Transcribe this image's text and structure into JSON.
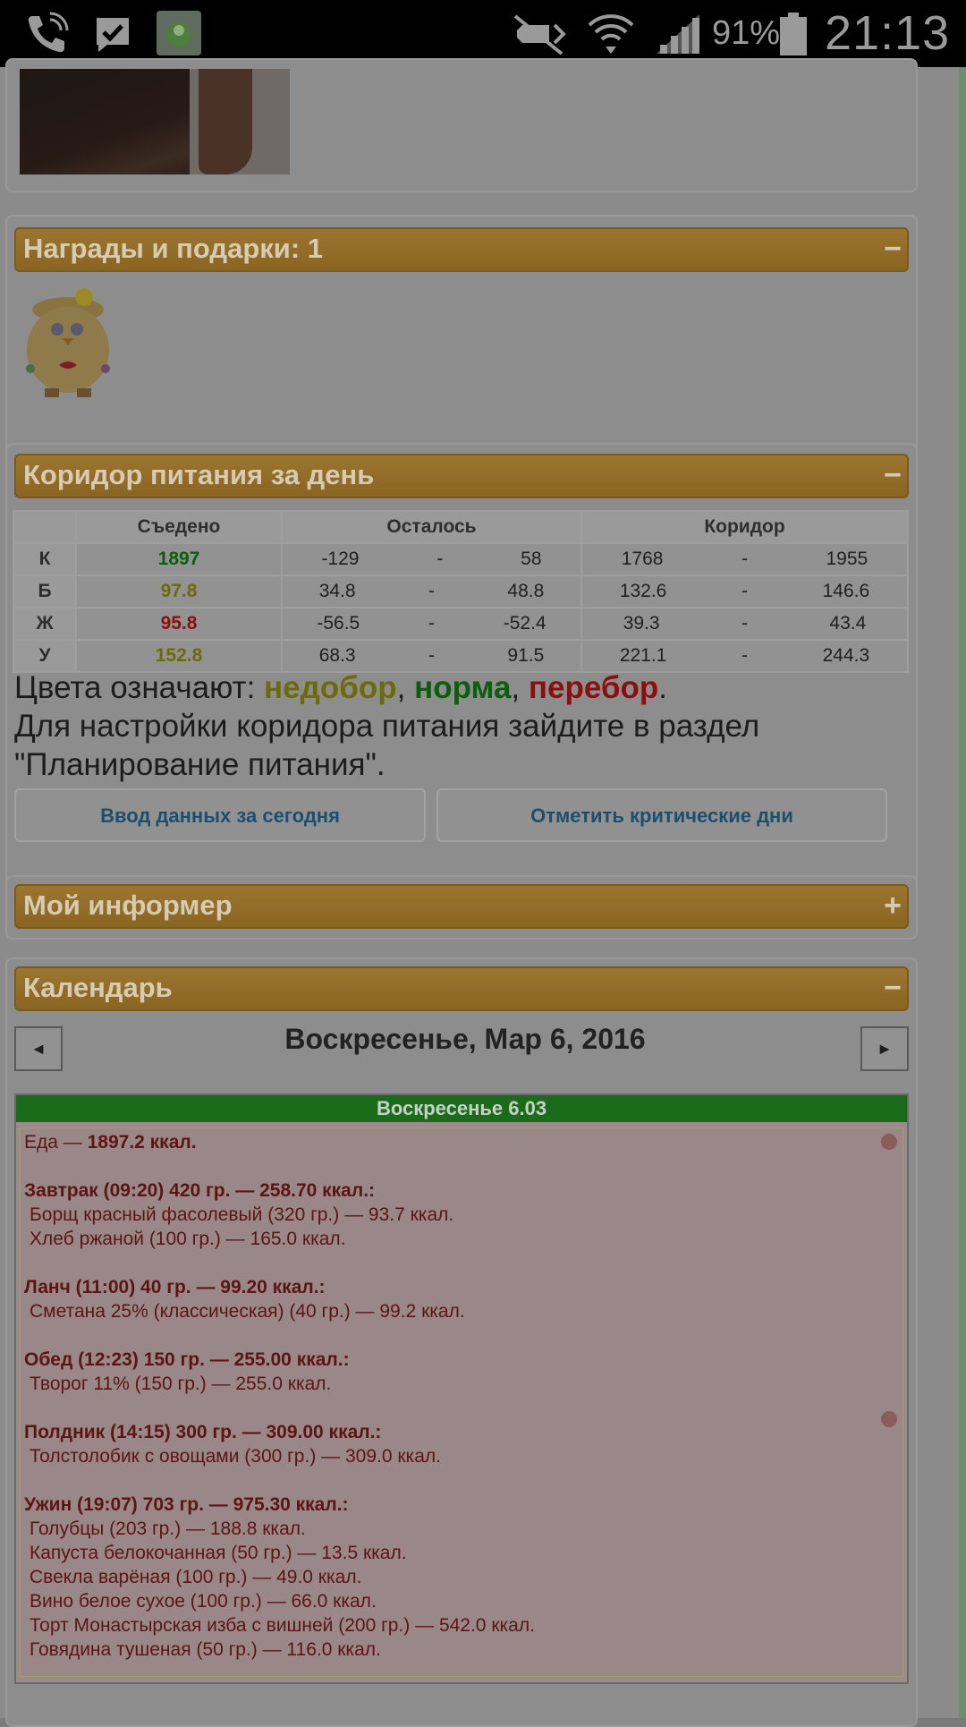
{
  "status_bar": {
    "battery": "91%",
    "time": "21:13",
    "icons": [
      "phone-icon",
      "check-icon",
      "app-icon",
      "mute-icon",
      "wifi-icon",
      "signal-icon",
      "battery-icon"
    ]
  },
  "awards": {
    "title": "Награды и подарки: 1",
    "toggle": "−"
  },
  "corridor": {
    "title": "Коридор питания за день",
    "toggle": "−",
    "headers": [
      "",
      "Съедено",
      "Осталось",
      "Коридор"
    ],
    "rows": [
      {
        "label": "К",
        "eaten": "1897",
        "eaten_status": "norm",
        "left_min": "-129",
        "left_max": "58",
        "corr_min": "1768",
        "corr_max": "1955"
      },
      {
        "label": "Б",
        "eaten": "97.8",
        "eaten_status": "under",
        "left_min": "34.8",
        "left_max": "48.8",
        "corr_min": "132.6",
        "corr_max": "146.6"
      },
      {
        "label": "Ж",
        "eaten": "95.8",
        "eaten_status": "over",
        "left_min": "-56.5",
        "left_max": "-52.4",
        "corr_min": "39.3",
        "corr_max": "43.4"
      },
      {
        "label": "У",
        "eaten": "152.8",
        "eaten_status": "under",
        "left_min": "68.3",
        "left_max": "91.5",
        "corr_min": "221.1",
        "corr_max": "244.3"
      }
    ],
    "dash": "-",
    "legend_prefix": "Цвета означают: ",
    "legend_under": "недобор",
    "legend_comma1": ", ",
    "legend_norm": "норма",
    "legend_comma2": ", ",
    "legend_over": "перебор",
    "legend_dot": ".",
    "hint": "Для настройки коридора питания зайдите в раздел \"Планирование питания\".",
    "button_input": "Ввод данных за сегодня",
    "button_critical": "Отметить критические дни",
    "colors": {
      "under": "#6b6b0a",
      "norm": "#0b5e0b",
      "over": "#8a1010"
    }
  },
  "informer": {
    "title": "Мой информер",
    "toggle": "+"
  },
  "calendar": {
    "title": "Календарь",
    "toggle": "−",
    "prev": "◄",
    "next": "►",
    "date": "Воскресенье, Мар 6, 2016",
    "day_header": "Воскресенье 6.03",
    "food_prefix": "Еда — ",
    "food_total": "1897.2 ккал.",
    "meals": [
      {
        "title": "Завтрак (09:20) 420 гр. — 258.70 ккал.:",
        "items": [
          "Борщ красный фасолевый (320 гр.) — 93.7 ккал.",
          "Хлеб ржаной (100 гр.) — 165.0 ккал."
        ]
      },
      {
        "title": "Ланч (11:00) 40 гр. — 99.20 ккал.:",
        "items": [
          "Сметана 25% (классическая) (40 гр.) — 99.2 ккал."
        ]
      },
      {
        "title": "Обед (12:23) 150 гр. — 255.00 ккал.:",
        "items": [
          "Творог 11% (150 гр.) — 255.0 ккал."
        ]
      },
      {
        "title": "Полдник (14:15) 300 гр. — 309.00 ккал.:",
        "items": [
          "Толстолобик с овощами (300 гр.) — 309.0 ккал."
        ]
      },
      {
        "title": "Ужин (19:07) 703 гр. — 975.30 ккал.:",
        "items": [
          "Голубцы (203 гр.) — 188.8 ккал.",
          "Капуста белокочанная (50 гр.) — 13.5 ккал.",
          "Свекла варёная (100 гр.) — 49.0 ккал.",
          "Вино белое сухое (100 гр.) — 66.0 ккал.",
          "Торт Монастырская изба с вишней (200 гр.) — 542.0 ккал.",
          "Говядина тушеная (50 гр.) — 116.0 ккал."
        ]
      }
    ]
  }
}
